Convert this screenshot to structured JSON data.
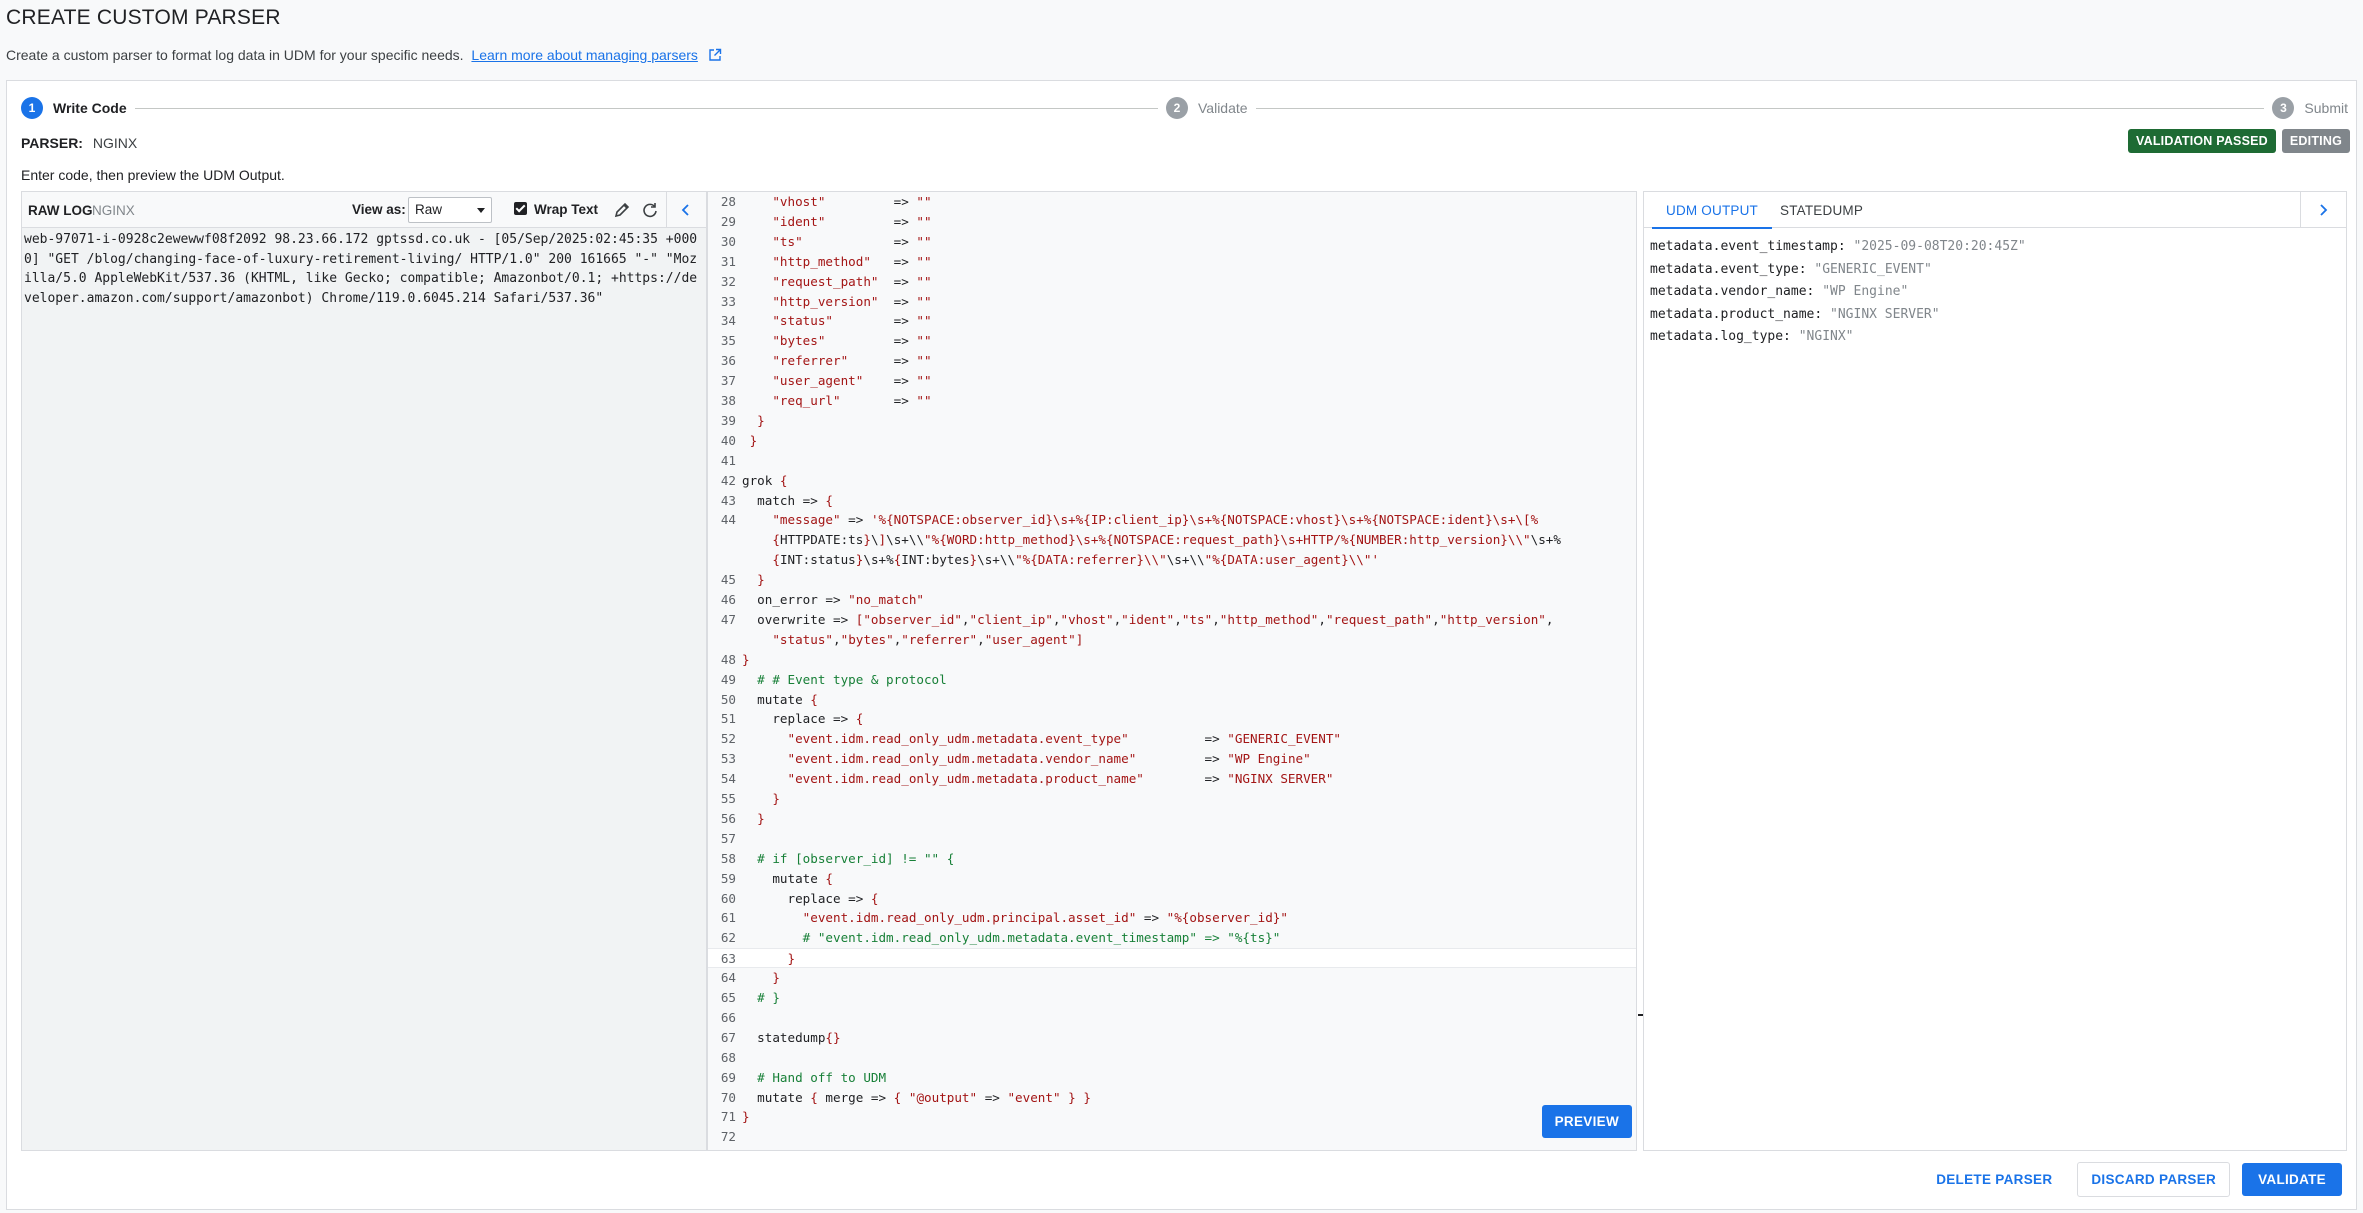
{
  "page": {
    "title": "CREATE CUSTOM PARSER",
    "description": "Create a custom parser to format log data in UDM for your specific needs.",
    "learn_more_link": "Learn more about managing parsers"
  },
  "stepper": {
    "steps": [
      {
        "num": "1",
        "label": "Write Code",
        "state": "active"
      },
      {
        "num": "2",
        "label": "Validate",
        "state": "inactive"
      },
      {
        "num": "3",
        "label": "Submit",
        "state": "inactive"
      }
    ]
  },
  "parser": {
    "label": "PARSER:",
    "value": "NGINX",
    "badge_validation": "VALIDATION PASSED",
    "badge_editing": "EDITING",
    "hint": "Enter code, then preview the UDM Output."
  },
  "raw_log": {
    "title": "RAW LOG",
    "source": "NGINX",
    "view_as_label": "View as:",
    "view_as_value": "Raw",
    "wrap_text_label": "Wrap Text",
    "wrap_text_checked": true,
    "content": "web-97071-i-0928c2ewewwf08f2092 98.23.66.172 gptssd.co.uk - [05/Sep/2025:02:45:35 +0000] \"GET /blog/changing-face-of-luxury-retirement-living/ HTTP/1.0\" 200 161665 \"-\" \"Mozilla/5.0 AppleWebKit/537.36 (KHTML, like Gecko; compatible; Amazonbot/0.1; +https://developer.amazon.com/support/amazonbot) Chrome/119.0.6045.214 Safari/537.36\""
  },
  "editor": {
    "preview_label": "PREVIEW",
    "cursor_line": "63",
    "lines": [
      {
        "n": "28",
        "text": "    \"vhost\"         => \"\""
      },
      {
        "n": "29",
        "text": "    \"ident\"         => \"\""
      },
      {
        "n": "30",
        "text": "    \"ts\"            => \"\""
      },
      {
        "n": "31",
        "text": "    \"http_method\"   => \"\""
      },
      {
        "n": "32",
        "text": "    \"request_path\"  => \"\""
      },
      {
        "n": "33",
        "text": "    \"http_version\"  => \"\""
      },
      {
        "n": "34",
        "text": "    \"status\"        => \"\""
      },
      {
        "n": "35",
        "text": "    \"bytes\"         => \"\""
      },
      {
        "n": "36",
        "text": "    \"referrer\"      => \"\""
      },
      {
        "n": "37",
        "text": "    \"user_agent\"    => \"\""
      },
      {
        "n": "38",
        "text": "    \"req_url\"       => \"\""
      },
      {
        "n": "39",
        "text": "  }"
      },
      {
        "n": "40",
        "text": " }"
      },
      {
        "n": "41",
        "text": ""
      },
      {
        "n": "42",
        "text": "grok {"
      },
      {
        "n": "43",
        "text": "  match => {"
      },
      {
        "n": "44",
        "text": "    \"message\" => '%{NOTSPACE:observer_id}\\s+%{IP:client_ip}\\s+%{NOTSPACE:vhost}\\s+%{NOTSPACE:ident}\\s+\\[%"
      },
      {
        "n": "",
        "text": "    {HTTPDATE:ts}\\]\\s+\\\\\"%{WORD:http_method}\\s+%{NOTSPACE:request_path}\\s+HTTP/%{NUMBER:http_version}\\\\\"\\s+%"
      },
      {
        "n": "",
        "text": "    {INT:status}\\s+%{INT:bytes}\\s+\\\\\"%{DATA:referrer}\\\\\"\\s+\\\\\"%{DATA:user_agent}\\\\\"'"
      },
      {
        "n": "45",
        "text": "  }"
      },
      {
        "n": "46",
        "text": "  on_error => \"no_match\""
      },
      {
        "n": "47",
        "text": "  overwrite => [\"observer_id\",\"client_ip\",\"vhost\",\"ident\",\"ts\",\"http_method\",\"request_path\",\"http_version\","
      },
      {
        "n": "",
        "text": "    \"status\",\"bytes\",\"referrer\",\"user_agent\"]"
      },
      {
        "n": "48",
        "text": "}"
      },
      {
        "n": "49",
        "text": "  # # Event type & protocol"
      },
      {
        "n": "50",
        "text": "  mutate {"
      },
      {
        "n": "51",
        "text": "    replace => {"
      },
      {
        "n": "52",
        "text": "      \"event.idm.read_only_udm.metadata.event_type\"          => \"GENERIC_EVENT\""
      },
      {
        "n": "53",
        "text": "      \"event.idm.read_only_udm.metadata.vendor_name\"         => \"WP Engine\""
      },
      {
        "n": "54",
        "text": "      \"event.idm.read_only_udm.metadata.product_name\"        => \"NGINX SERVER\""
      },
      {
        "n": "55",
        "text": "    }"
      },
      {
        "n": "56",
        "text": "  }"
      },
      {
        "n": "57",
        "text": ""
      },
      {
        "n": "58",
        "text": "  # if [observer_id] != \"\" {"
      },
      {
        "n": "59",
        "text": "    mutate {"
      },
      {
        "n": "60",
        "text": "      replace => {"
      },
      {
        "n": "61",
        "text": "        \"event.idm.read_only_udm.principal.asset_id\" => \"%{observer_id}\""
      },
      {
        "n": "62",
        "text": "        # \"event.idm.read_only_udm.metadata.event_timestamp\" => \"%{ts}\""
      },
      {
        "n": "63",
        "text": "      }"
      },
      {
        "n": "64",
        "text": "    }"
      },
      {
        "n": "65",
        "text": "  # }"
      },
      {
        "n": "66",
        "text": ""
      },
      {
        "n": "67",
        "text": "  statedump{}"
      },
      {
        "n": "68",
        "text": ""
      },
      {
        "n": "69",
        "text": "  # Hand off to UDM"
      },
      {
        "n": "70",
        "text": "  mutate { merge => { \"@output\" => \"event\" } }"
      },
      {
        "n": "71",
        "text": "}"
      },
      {
        "n": "72",
        "text": ""
      }
    ]
  },
  "output": {
    "tab_udm": "UDM OUTPUT",
    "tab_statedump": "STATEDUMP",
    "fields": [
      {
        "key": "metadata.event_timestamp:",
        "value": "\"2025-09-08T20:20:45Z\""
      },
      {
        "key": "metadata.event_type:",
        "value": "\"GENERIC_EVENT\""
      },
      {
        "key": "metadata.vendor_name:",
        "value": "\"WP Engine\""
      },
      {
        "key": "metadata.product_name:",
        "value": "\"NGINX SERVER\""
      },
      {
        "key": "metadata.log_type:",
        "value": "\"NGINX\""
      }
    ]
  },
  "footer": {
    "delete": "DELETE PARSER",
    "discard": "DISCARD PARSER",
    "validate": "VALIDATE"
  },
  "colors": {
    "accent": "#1a73e8",
    "passed": "#1e6b34",
    "editing": "#80868b",
    "code_string": "#a31515",
    "code_comment": "#188038",
    "code_brace": "#a31515"
  },
  "icons": [
    "external-link-icon",
    "pencil-icon",
    "refresh-icon",
    "chevron-left-icon",
    "chevron-right-icon",
    "checkbox-icon",
    "caret-down-icon"
  ]
}
